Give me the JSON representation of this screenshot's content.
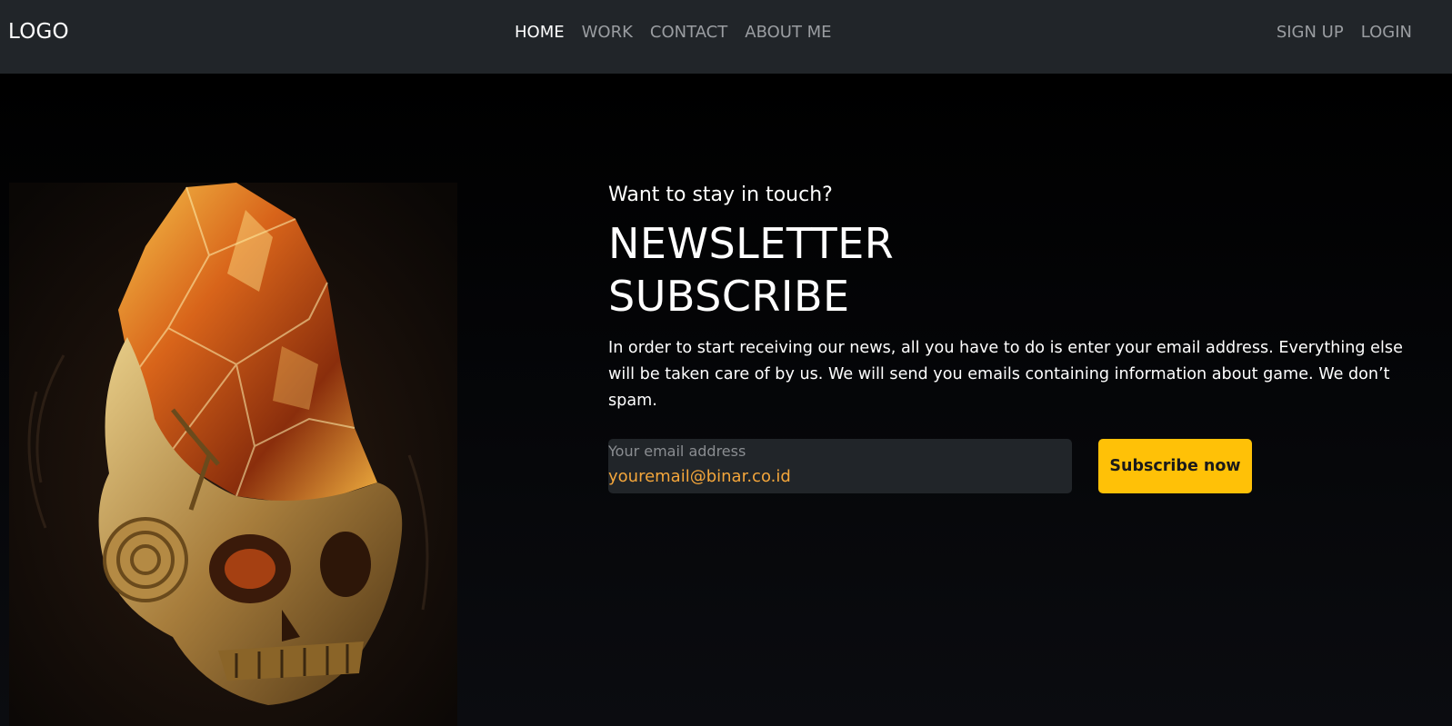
{
  "nav": {
    "logo": "LOGO",
    "links": [
      {
        "label": "HOME",
        "active": true
      },
      {
        "label": "WORK",
        "active": false
      },
      {
        "label": "CONTACT",
        "active": false
      },
      {
        "label": "ABOUT ME",
        "active": false
      }
    ],
    "auth": {
      "signup": "SIGN UP",
      "login": "LOGIN"
    }
  },
  "hero": {
    "image_icon": "crystal-skull-illustration"
  },
  "newsletter": {
    "kicker": "Want to stay in touch?",
    "headline": "NEWSLETTER SUBSCRIBE",
    "description": "In order to start receiving our news, all you have to do is enter your email address. Everything else will be taken care of by us. We will send you emails containing information about game. We don’t spam.",
    "email_label": "Your email address",
    "email_value": "youremail@binar.co.id",
    "button_label": "Subscribe now"
  },
  "colors": {
    "navbar": "#212529",
    "background": "#000000",
    "accent": "#ffc107",
    "email_text": "#f4a63b",
    "nav_inactive": "#9a9da1"
  }
}
